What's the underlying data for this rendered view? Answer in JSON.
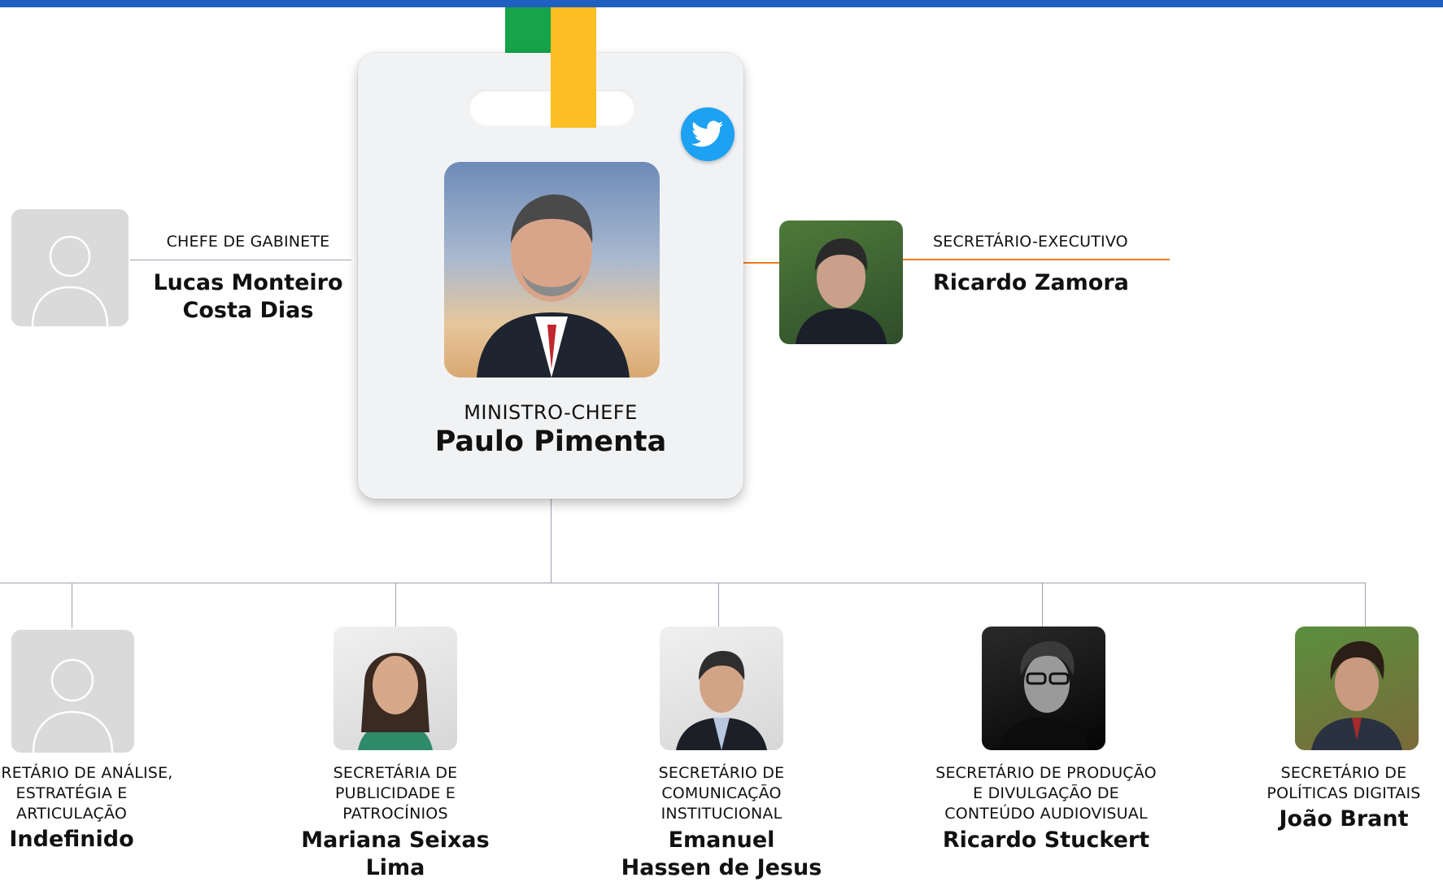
{
  "minister": {
    "title": "MINISTRO-CHEFE",
    "name": "Paulo Pimenta"
  },
  "chief_of_staff": {
    "title": "CHEFE DE GABINETE",
    "name_line1": "Lucas Monteiro",
    "name_line2": "Costa Dias"
  },
  "executive_secretary": {
    "title": "SECRETÁRIO-EXECUTIVO",
    "name": "Ricardo Zamora"
  },
  "secretaries": [
    {
      "title_lines": [
        "SECRETÁRIO DE ANÁLISE,",
        "ESTRATÉGIA E",
        "ARTICULAÇÃO"
      ],
      "name_lines": [
        "Indefinido"
      ]
    },
    {
      "title_lines": [
        "SECRETÁRIA DE",
        "PUBLICIDADE E",
        "PATROCÍNIOS"
      ],
      "name_lines": [
        "Mariana Seixas",
        "Lima"
      ]
    },
    {
      "title_lines": [
        "SECRETÁRIO DE",
        "COMUNICAÇÃO",
        "INSTITUCIONAL"
      ],
      "name_lines": [
        "Emanuel",
        "Hassen de Jesus"
      ]
    },
    {
      "title_lines": [
        "SECRETÁRIO DE PRODUÇÃO",
        "E DIVULGAÇÃO DE",
        "CONTEÚDO AUDIOVISUAL"
      ],
      "name_lines": [
        "Ricardo Stuckert"
      ]
    },
    {
      "title_lines": [
        "SECRETÁRIO  DE",
        "POLÍTICAS DIGITAIS"
      ],
      "name_lines": [
        "João Brant"
      ]
    }
  ],
  "colors": {
    "accent_blue": "#1f5fbf",
    "strap_green": "#16a34a",
    "strap_yellow": "#fbbf24",
    "connector_orange": "#f07a1c",
    "twitter_blue": "#1da1f2"
  },
  "icons": [
    "twitter-icon",
    "person-placeholder-icon"
  ]
}
